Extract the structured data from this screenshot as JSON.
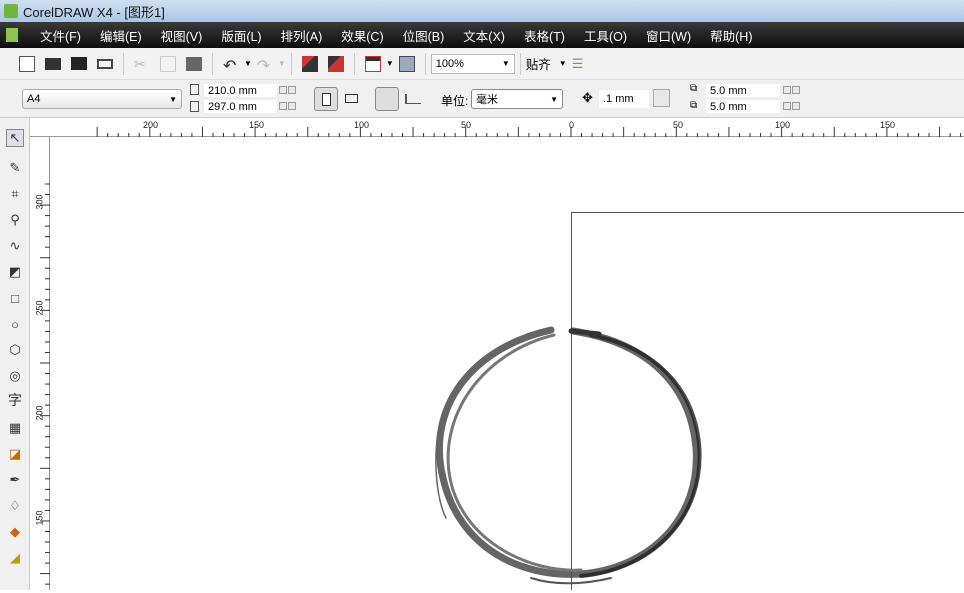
{
  "window": {
    "title": "CorelDRAW X4 - [图形1]"
  },
  "menu": [
    "文件(F)",
    "编辑(E)",
    "视图(V)",
    "版面(L)",
    "排列(A)",
    "效果(C)",
    "位图(B)",
    "文本(X)",
    "表格(T)",
    "工具(O)",
    "窗口(W)",
    "帮助(H)"
  ],
  "toolbar": {
    "zoom": "100%",
    "snap": "贴齐"
  },
  "property_bar": {
    "page_size": "A4",
    "width": "210.0 mm",
    "height": "297.0 mm",
    "unit_label": "单位:",
    "unit": "毫米",
    "nudge": ".1 mm",
    "dup_x": "5.0 mm",
    "dup_y": "5.0 mm"
  },
  "ruler": {
    "h": [
      "200",
      "150",
      "100",
      "50",
      "0",
      "50",
      "100",
      "150"
    ],
    "v": [
      "300",
      "250",
      "200",
      "150"
    ]
  },
  "toolbox": {
    "text_tool": "字"
  }
}
